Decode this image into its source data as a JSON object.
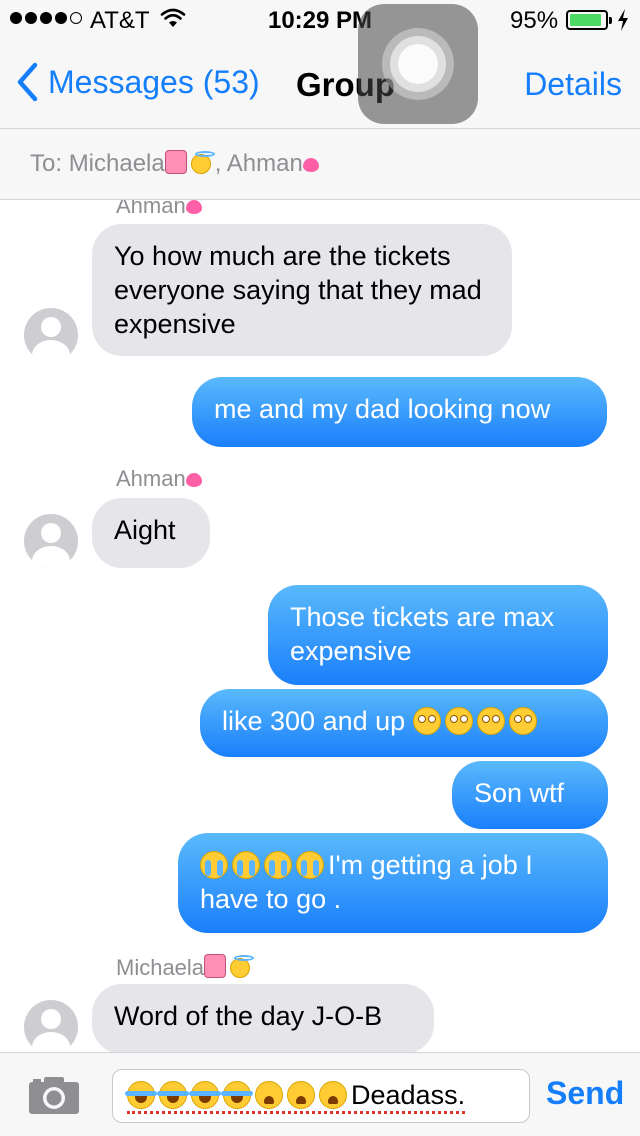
{
  "status_bar": {
    "signal": "signal-dots-4-of-5",
    "carrier": "AT&T",
    "time": "10:29 PM",
    "battery_percent": "95%",
    "battery_level": 0.95,
    "icons": [
      "wifi-icon",
      "battery-icon",
      "charging-bolt-icon"
    ]
  },
  "nav": {
    "back_label": "Messages (53)",
    "title": "Group",
    "details_label": "Details"
  },
  "to_bar": {
    "prefix": "To: ",
    "recipient_1": "Michaela",
    "separator": ", ",
    "recipient_2": "Ahman"
  },
  "colors": {
    "accent": "#157efb",
    "incoming_bubble": "#e5e5ea",
    "outgoing_top": "#5ab9fb",
    "outgoing_bottom": "#1a7ffb"
  },
  "messages": [
    {
      "id": "m1",
      "direction": "incoming",
      "sender": "Ahman",
      "text": "Yo how much are the tickets everyone saying that they mad expensive"
    },
    {
      "id": "m2",
      "direction": "outgoing",
      "text": "me and my dad looking now"
    },
    {
      "id": "m3",
      "direction": "incoming",
      "sender": "Ahman",
      "text": "Aight"
    },
    {
      "id": "m4",
      "direction": "outgoing",
      "text": "Those tickets are max expensive"
    },
    {
      "id": "m5",
      "direction": "outgoing",
      "text": "like 300 and up",
      "emoji": [
        "face-with-rolling-eyes",
        "face-with-rolling-eyes",
        "face-with-rolling-eyes",
        "face-with-rolling-eyes"
      ]
    },
    {
      "id": "m6",
      "direction": "outgoing",
      "text": "Son wtf"
    },
    {
      "id": "m7",
      "direction": "outgoing",
      "text": "I'm getting a job I have to go .",
      "emoji": [
        "loudly-crying-face",
        "loudly-crying-face",
        "loudly-crying-face",
        "loudly-crying-face"
      ]
    },
    {
      "id": "m8",
      "direction": "incoming",
      "sender": "Michaela",
      "text": "Word of the day J-O-B"
    }
  ],
  "sender_emoji": {
    "Ahman": [
      "two-hearts"
    ],
    "Michaela": [
      "two-women-holding-hands",
      "smiling-face-with-halo"
    ]
  },
  "composer": {
    "text": "Deadass.",
    "emoji": [
      "face-with-tears-of-joy",
      "face-with-tears-of-joy",
      "face-with-tears-of-joy",
      "face-with-tears-of-joy",
      "weary-face",
      "weary-face",
      "weary-face"
    ],
    "send_label": "Send",
    "camera_icon": "camera-icon"
  }
}
